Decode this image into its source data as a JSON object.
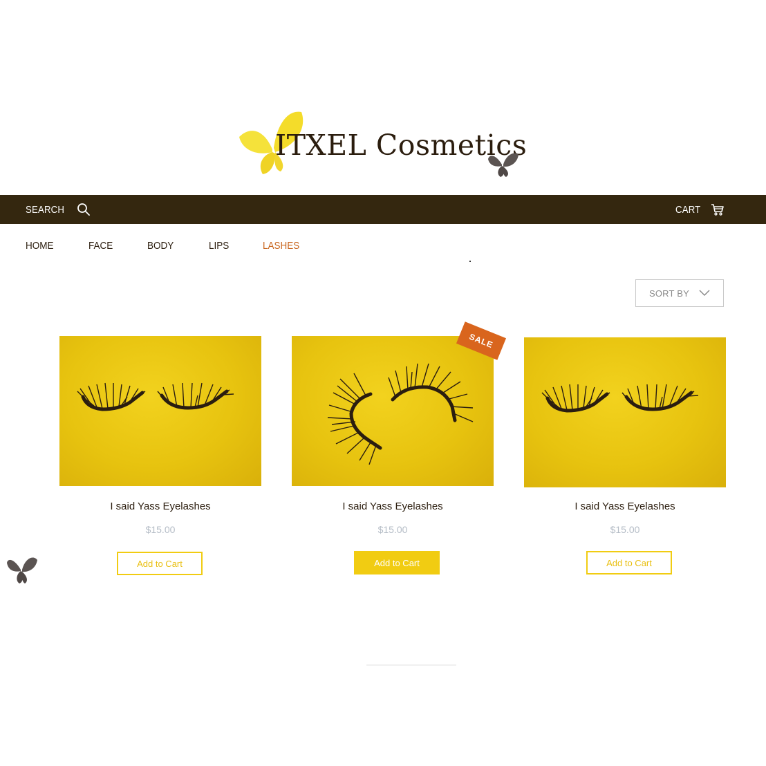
{
  "brand": {
    "name": "ITXEL Cosmetics",
    "accent_yellow": "#f1cc12",
    "bar_color": "#34270f",
    "active_nav_color": "#c8641c",
    "sale_color": "#d9651d"
  },
  "topbar": {
    "search_label": "SEARCH",
    "search_icon": "search-icon",
    "cart_label": "CART",
    "cart_icon": "cart-icon"
  },
  "nav": {
    "items": [
      {
        "label": "HOME",
        "active": false
      },
      {
        "label": "FACE",
        "active": false
      },
      {
        "label": "BODY",
        "active": false
      },
      {
        "label": "LIPS",
        "active": false
      },
      {
        "label": "LASHES",
        "active": true
      }
    ]
  },
  "sort": {
    "label": "SORT BY",
    "icon": "chevron-down-icon"
  },
  "products": [
    {
      "name": "I said Yass Eyelashes",
      "price": "$15.00",
      "button": "Add to Cart",
      "sale": false,
      "button_style": "outline"
    },
    {
      "name": "I said Yass Eyelashes",
      "price": "$15.00",
      "button": "Add to Cart",
      "sale": true,
      "sale_label": "SALE",
      "button_style": "filled"
    },
    {
      "name": "I said Yass Eyelashes",
      "price": "$15.00",
      "button": "Add to Cart",
      "sale": false,
      "button_style": "outline"
    }
  ]
}
